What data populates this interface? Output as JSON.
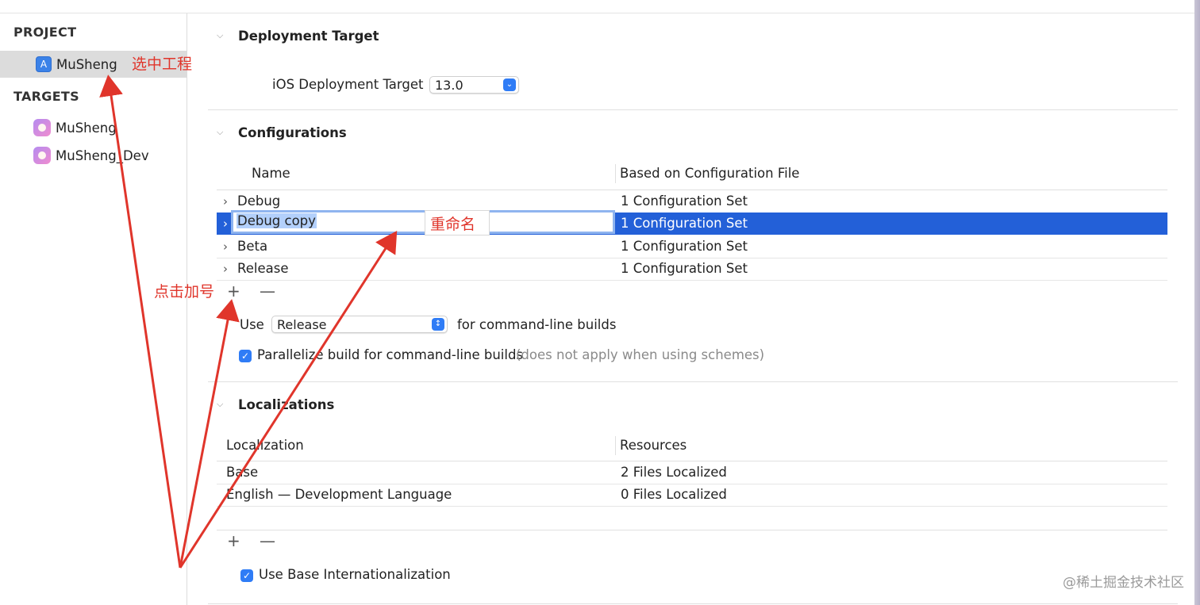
{
  "sidebar": {
    "project_header": "PROJECT",
    "project_item": "MuSheng",
    "targets_header": "TARGETS",
    "targets": [
      "MuSheng",
      "MuSheng_Dev"
    ]
  },
  "deployment": {
    "title": "Deployment Target",
    "label": "iOS Deployment Target",
    "value": "13.0"
  },
  "configurations": {
    "title": "Configurations",
    "headers": [
      "Name",
      "Based on Configuration File"
    ],
    "rows": [
      {
        "name": "Debug",
        "file": "1 Configuration Set"
      },
      {
        "name": "Debug copy",
        "file": "1 Configuration Set"
      },
      {
        "name": "Beta",
        "file": "1 Configuration Set"
      },
      {
        "name": "Release",
        "file": "1 Configuration Set"
      }
    ],
    "add": "+",
    "remove": "—",
    "use_label": "Use",
    "use_value": "Release",
    "use_suffix": "for command-line builds",
    "parallelize_label": "Parallelize build for command-line builds",
    "parallelize_note": "(does not apply when using schemes)"
  },
  "localizations": {
    "title": "Localizations",
    "headers": [
      "Localization",
      "Resources"
    ],
    "rows": [
      {
        "name": "Base",
        "resources": "2 Files Localized"
      },
      {
        "name": "English — Development Language",
        "resources": "0 Files Localized"
      }
    ],
    "add": "+",
    "remove": "—",
    "use_base_label": "Use Base Internationalization"
  },
  "annotations": {
    "select_project": "选中工程",
    "rename": "重命名",
    "click_plus": "点击加号",
    "color": "#e0352b"
  },
  "watermark": "@稀土掘金技术社区",
  "colors": {
    "selection": "#2360d8",
    "accent": "#2f7cf6"
  }
}
